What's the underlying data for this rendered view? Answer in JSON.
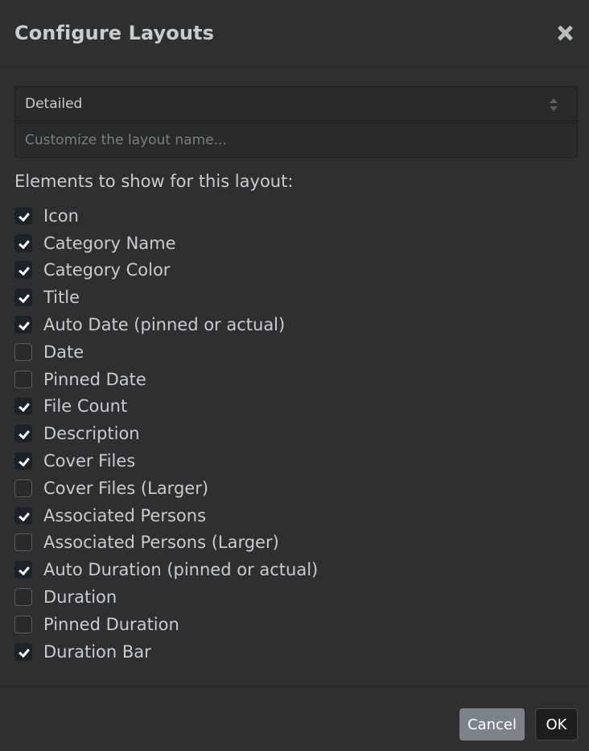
{
  "dialog": {
    "title": "Configure Layouts"
  },
  "layout_select": {
    "value": "Detailed"
  },
  "name_input": {
    "value": "",
    "placeholder": "Customize the layout name..."
  },
  "elements_label": "Elements to show for this layout:",
  "options": [
    {
      "label": "Icon",
      "checked": true
    },
    {
      "label": "Category Name",
      "checked": true
    },
    {
      "label": "Category Color",
      "checked": true
    },
    {
      "label": "Title",
      "checked": true
    },
    {
      "label": "Auto Date (pinned or actual)",
      "checked": true
    },
    {
      "label": "Date",
      "checked": false
    },
    {
      "label": "Pinned Date",
      "checked": false
    },
    {
      "label": "File Count",
      "checked": true
    },
    {
      "label": "Description",
      "checked": true
    },
    {
      "label": "Cover Files",
      "checked": true
    },
    {
      "label": "Cover Files (Larger)",
      "checked": false
    },
    {
      "label": "Associated Persons",
      "checked": true
    },
    {
      "label": "Associated Persons (Larger)",
      "checked": false
    },
    {
      "label": "Auto Duration (pinned or actual)",
      "checked": true
    },
    {
      "label": "Duration",
      "checked": false
    },
    {
      "label": "Pinned Duration",
      "checked": false
    },
    {
      "label": "Duration Bar",
      "checked": true
    }
  ],
  "footer": {
    "cancel_label": "Cancel",
    "ok_label": "OK"
  },
  "colors": {
    "background": "#2f2f2f",
    "text": "#c9cbce",
    "checkbox_checked": "#1c2229",
    "cancel_button": "#7c8288",
    "ok_button": "#1e1e1e"
  },
  "icons": {
    "close": "close-icon",
    "select_arrows": "sort-arrows-icon",
    "checkmark": "checkmark-icon"
  }
}
